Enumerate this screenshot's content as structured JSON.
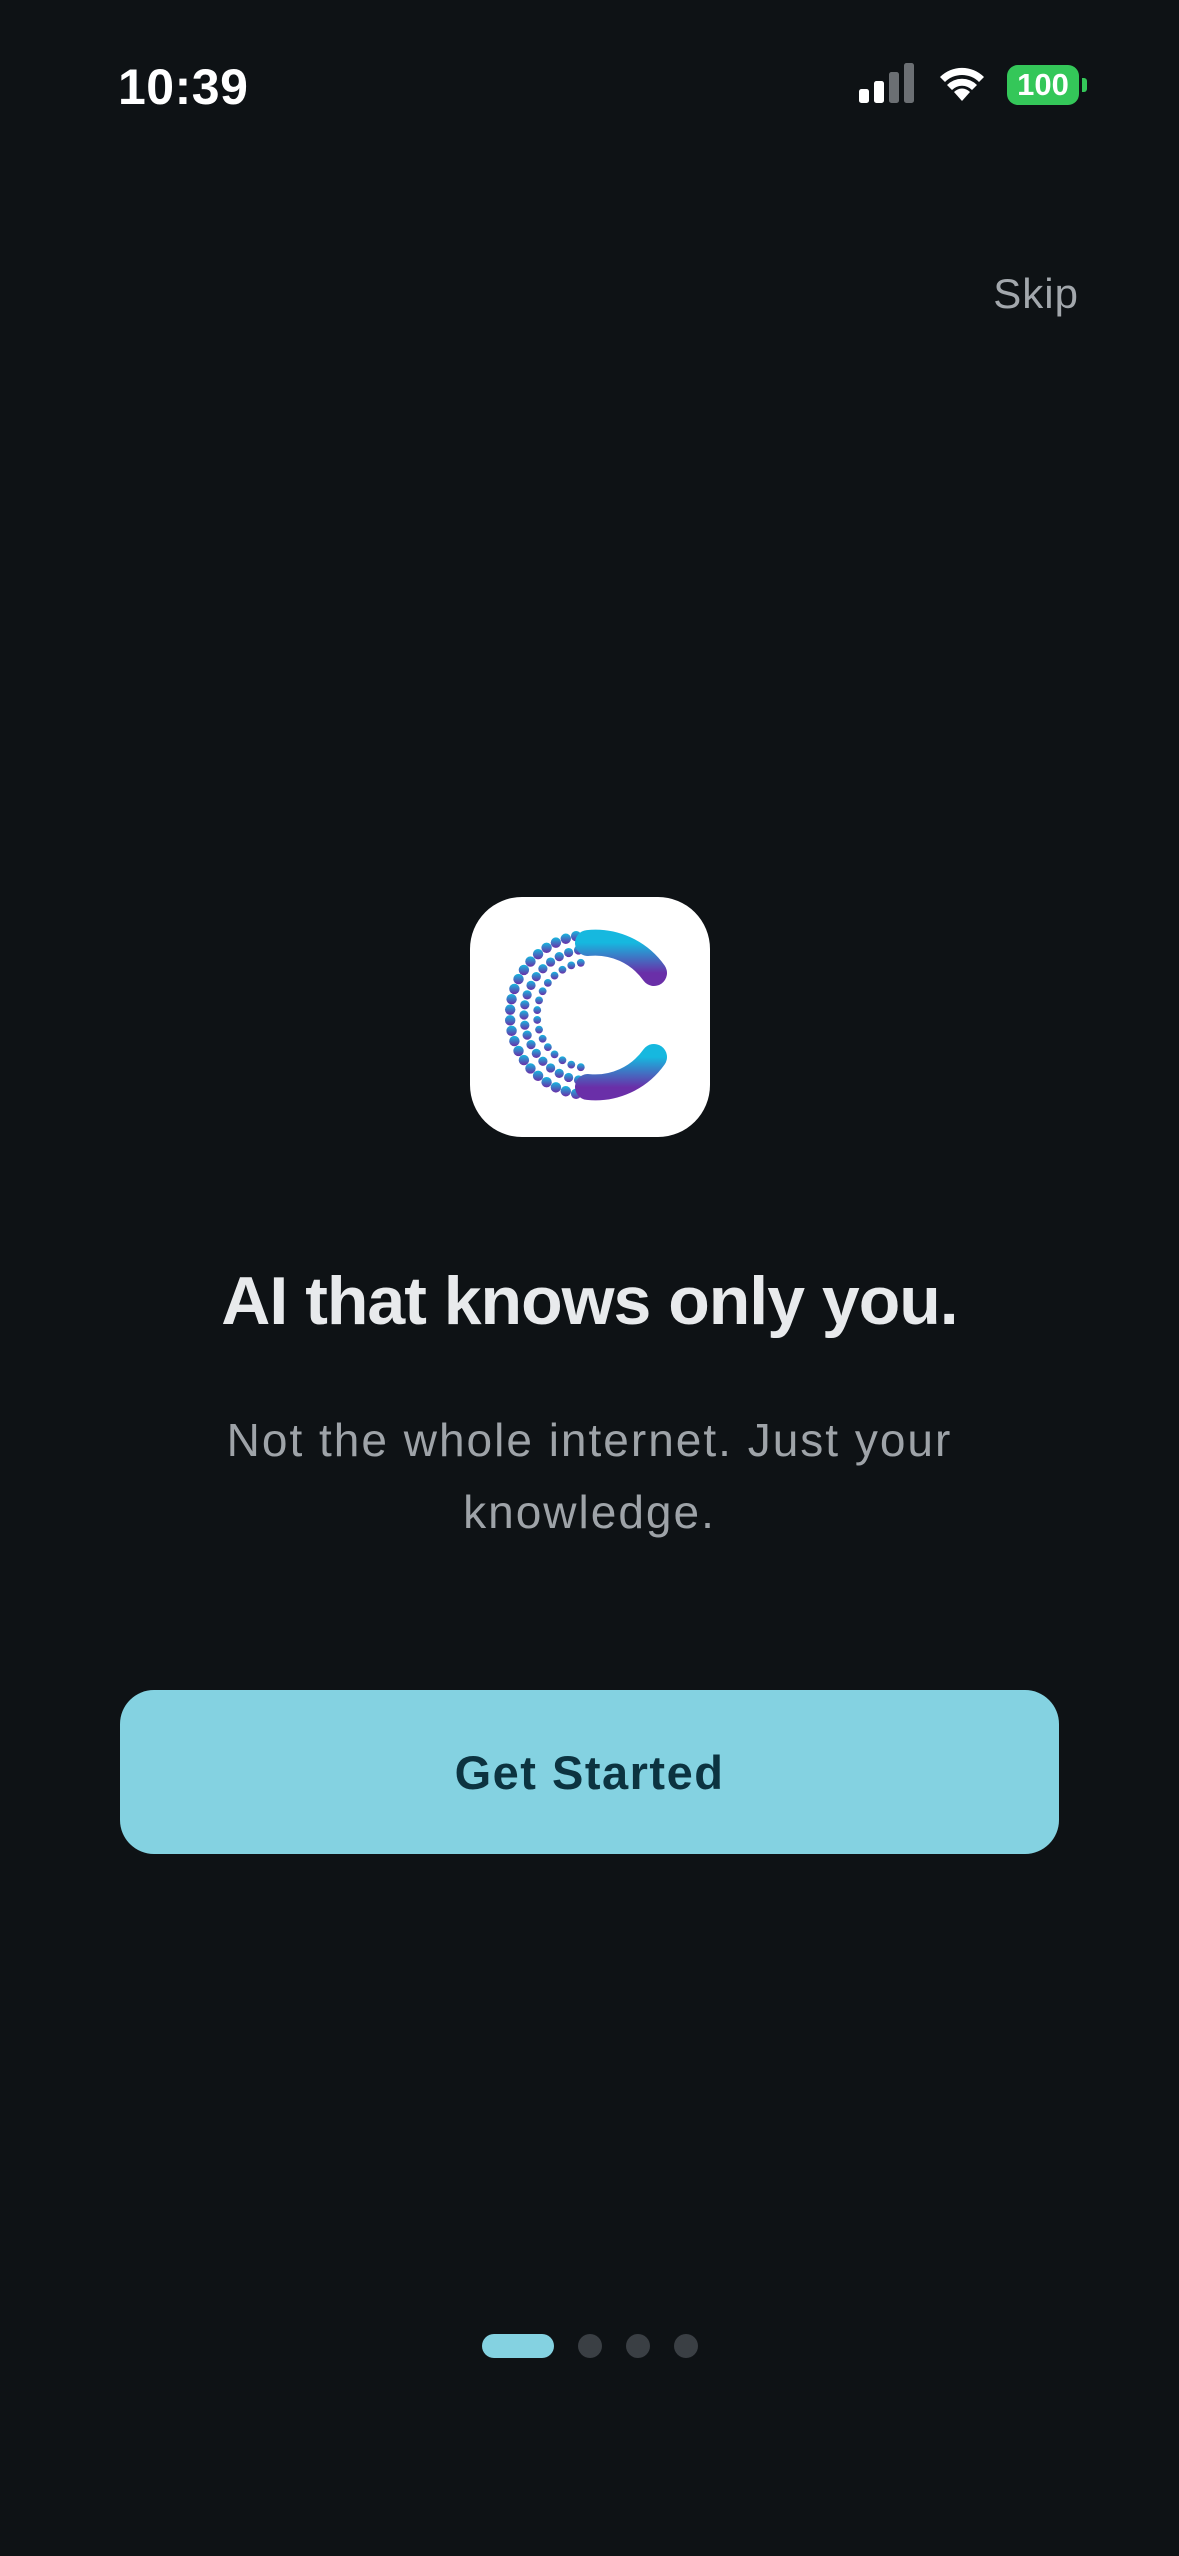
{
  "status_bar": {
    "time": "10:39",
    "battery": "100",
    "battery_color": "#34c759",
    "signal_icon": "cellular-signal-icon",
    "wifi_icon": "wifi-icon"
  },
  "skip_label": "Skip",
  "logo": {
    "icon": "app-logo-icon",
    "gradient_start": "#16b8df",
    "gradient_end": "#6a2fa8"
  },
  "headline": "AI that knows only you.",
  "subtitle": "Not the whole internet. Just your knowledge.",
  "cta": {
    "label": "Get Started",
    "background": "#84d2e1",
    "text_color": "#0c3340"
  },
  "pager": {
    "pages": 4,
    "current": 1
  },
  "colors": {
    "background": "#0e1215",
    "accent": "#84d2e1"
  }
}
